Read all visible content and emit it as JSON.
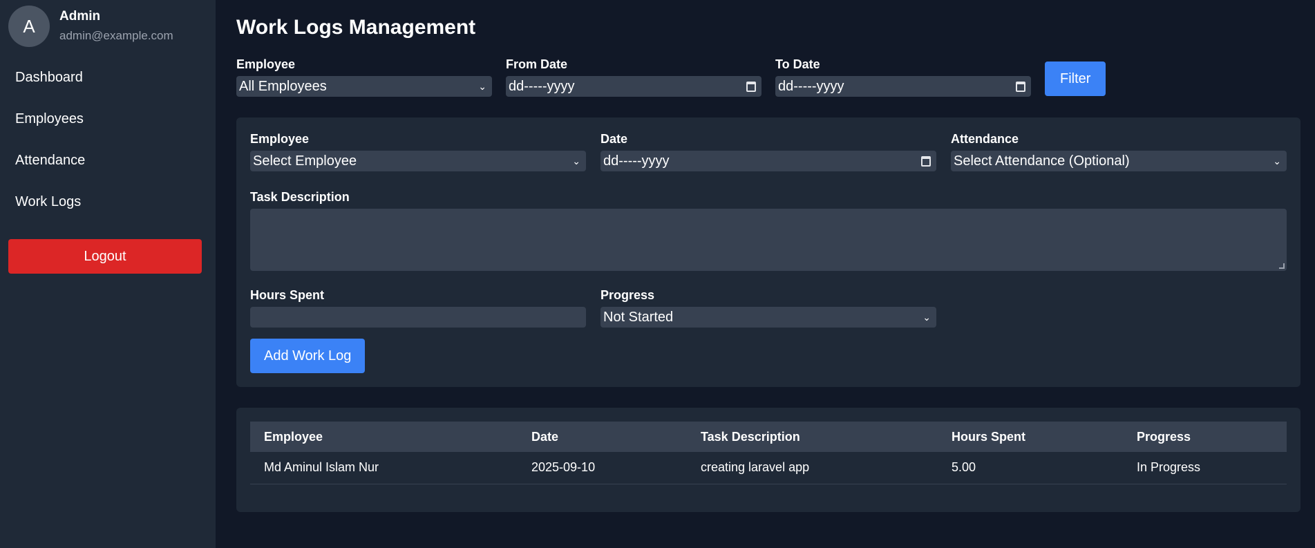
{
  "sidebar": {
    "avatar_initial": "A",
    "user_name": "Admin",
    "user_email": "admin@example.com",
    "nav": [
      "Dashboard",
      "Employees",
      "Attendance",
      "Work Logs"
    ],
    "logout_label": "Logout"
  },
  "page": {
    "title": "Work Logs Management"
  },
  "filter": {
    "employee_label": "Employee",
    "employee_value": "All Employees",
    "from_label": "From Date",
    "from_value": "dd-----yyyy",
    "to_label": "To Date",
    "to_value": "dd-----yyyy",
    "button_label": "Filter"
  },
  "form": {
    "employee_label": "Employee",
    "employee_value": "Select Employee",
    "date_label": "Date",
    "date_value": "dd-----yyyy",
    "attendance_label": "Attendance",
    "attendance_value": "Select Attendance (Optional)",
    "task_label": "Task Description",
    "task_value": "",
    "hours_label": "Hours Spent",
    "hours_value": "",
    "progress_label": "Progress",
    "progress_value": "Not Started",
    "submit_label": "Add Work Log"
  },
  "table": {
    "headers": [
      "Employee",
      "Date",
      "Task Description",
      "Hours Spent",
      "Progress"
    ],
    "rows": [
      [
        "Md Aminul Islam Nur",
        "2025-09-10",
        "creating laravel app",
        "5.00",
        "In Progress"
      ]
    ]
  },
  "colors": {
    "page_bg": "#111827",
    "sidebar_bg": "#1f2937",
    "field_bg": "#374151",
    "accent": "#3b82f6",
    "danger": "#dc2626"
  }
}
